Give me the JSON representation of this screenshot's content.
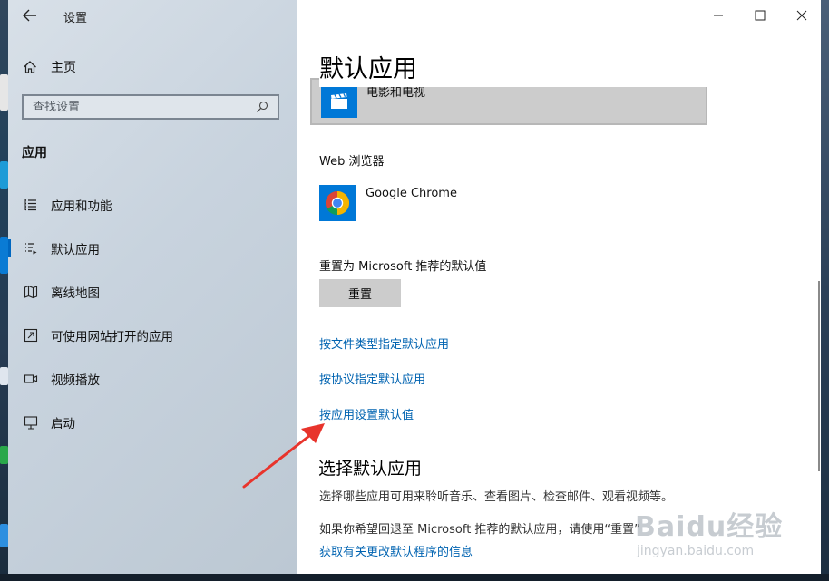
{
  "window": {
    "title": "设置",
    "controls": {
      "minimize": "minimize",
      "maximize": "maximize",
      "close": "close"
    }
  },
  "sidebar": {
    "home_label": "主页",
    "search_placeholder": "查找设置",
    "section_title": "应用",
    "items": [
      {
        "label": "应用和功能",
        "icon": "list-icon",
        "active": false
      },
      {
        "label": "默认应用",
        "icon": "default-apps-icon",
        "active": true
      },
      {
        "label": "离线地图",
        "icon": "map-icon",
        "active": false
      },
      {
        "label": "可使用网站打开的应用",
        "icon": "open-in-icon",
        "active": false
      },
      {
        "label": "视频播放",
        "icon": "video-icon",
        "active": false
      },
      {
        "label": "启动",
        "icon": "startup-icon",
        "active": false
      }
    ]
  },
  "main": {
    "page_title": "默认应用",
    "video_player": {
      "app_name": "电影和电视"
    },
    "web_browser": {
      "label": "Web 浏览器",
      "app_name": "Google Chrome"
    },
    "reset": {
      "label": "重置为 Microsoft 推荐的默认值",
      "button": "重置"
    },
    "links": {
      "by_file_type": "按文件类型指定默认应用",
      "by_protocol": "按协议指定默认应用",
      "by_app": "按应用设置默认值"
    },
    "choose_section": {
      "title": "选择默认应用",
      "description": "选择哪些应用可用来聆听音乐、查看图片、检查邮件、观看视频等。",
      "reset_note": "如果你希望回退至 Microsoft 推荐的默认应用，请使用“重置”",
      "more_info_link": "获取有关更改默认程序的信息"
    }
  },
  "watermark": {
    "brand": "Baidu经验",
    "site": "jingyan.baidu.com"
  },
  "colors": {
    "accent": "#0078d7",
    "link": "#0063b1",
    "annotation_arrow": "#e8342c"
  }
}
